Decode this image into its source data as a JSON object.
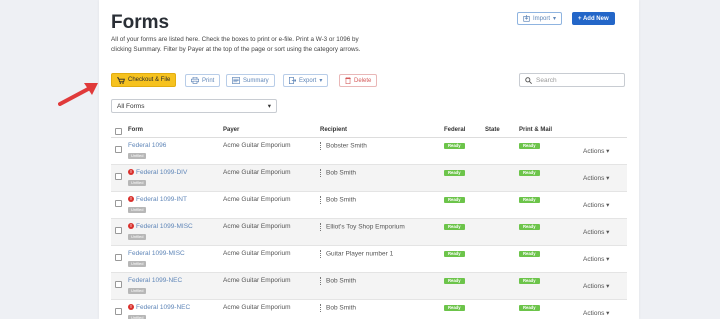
{
  "page": {
    "title": "Forms",
    "description": "All of your forms are listed here. Check the boxes to print or e-file. Print a W-3 or 1096 by clicking Summary. Filter by Payer at the top of the page or sort using the category arrows."
  },
  "header_actions": {
    "import_label": "Import",
    "add_new_label": "+ Add New"
  },
  "toolbar": {
    "checkout_label": "Checkout & File",
    "print_label": "Print",
    "summary_label": "Summary",
    "export_label": "Export",
    "delete_label": "Delete"
  },
  "search": {
    "placeholder": "Search"
  },
  "filter": {
    "selected": "All Forms"
  },
  "table": {
    "columns": [
      "Form",
      "Payer",
      "Recipient",
      "Federal",
      "State",
      "Print & Mail"
    ],
    "rows": [
      {
        "form": "Federal 1096",
        "error": false,
        "tag": "Unfiled",
        "payer": "Acme Guitar Emporium",
        "recipient": "Bobster Smith",
        "federal": "Ready",
        "state": "",
        "print": "Ready",
        "actions": "Actions"
      },
      {
        "form": "Federal 1099-DIV",
        "error": true,
        "tag": "Unfiled",
        "payer": "Acme Guitar Emporium",
        "recipient": "Bob Smith",
        "federal": "Ready",
        "state": "",
        "print": "Ready",
        "actions": "Actions"
      },
      {
        "form": "Federal 1099-INT",
        "error": true,
        "tag": "Unfiled",
        "payer": "Acme Guitar Emporium",
        "recipient": "Bob Smith",
        "federal": "Ready",
        "state": "",
        "print": "Ready",
        "actions": "Actions"
      },
      {
        "form": "Federal 1099-MISC",
        "error": true,
        "tag": "Unfiled",
        "payer": "Acme Guitar Emporium",
        "recipient": "Elliot's Toy Shop Emporium",
        "federal": "Ready",
        "state": "",
        "print": "Ready",
        "actions": "Actions"
      },
      {
        "form": "Federal 1099-MISC",
        "error": false,
        "tag": "Unfiled",
        "payer": "Acme Guitar Emporium",
        "recipient": "Guitar Player number 1",
        "federal": "Ready",
        "state": "",
        "print": "Ready",
        "actions": "Actions"
      },
      {
        "form": "Federal 1099-NEC",
        "error": false,
        "tag": "Unfiled",
        "payer": "Acme Guitar Emporium",
        "recipient": "Bob Smith",
        "federal": "Ready",
        "state": "",
        "print": "Ready",
        "actions": "Actions"
      },
      {
        "form": "Federal 1099-NEC",
        "error": true,
        "tag": "Unfiled",
        "payer": "Acme Guitar Emporium",
        "recipient": "Bob Smith",
        "federal": "Ready",
        "state": "",
        "print": "Ready",
        "actions": "Actions"
      }
    ]
  },
  "colors": {
    "accent": "#2366c8",
    "checkout": "#f6c21f",
    "ready": "#6cc44a",
    "error": "#d9302c",
    "arrow": "#e03a3a"
  },
  "icons": [
    "cart-icon",
    "print-icon",
    "summary-icon",
    "export-icon",
    "trash-icon",
    "search-icon",
    "import-icon",
    "error-icon",
    "drag-handle-icon",
    "caret-down-icon",
    "annotation-arrow"
  ]
}
